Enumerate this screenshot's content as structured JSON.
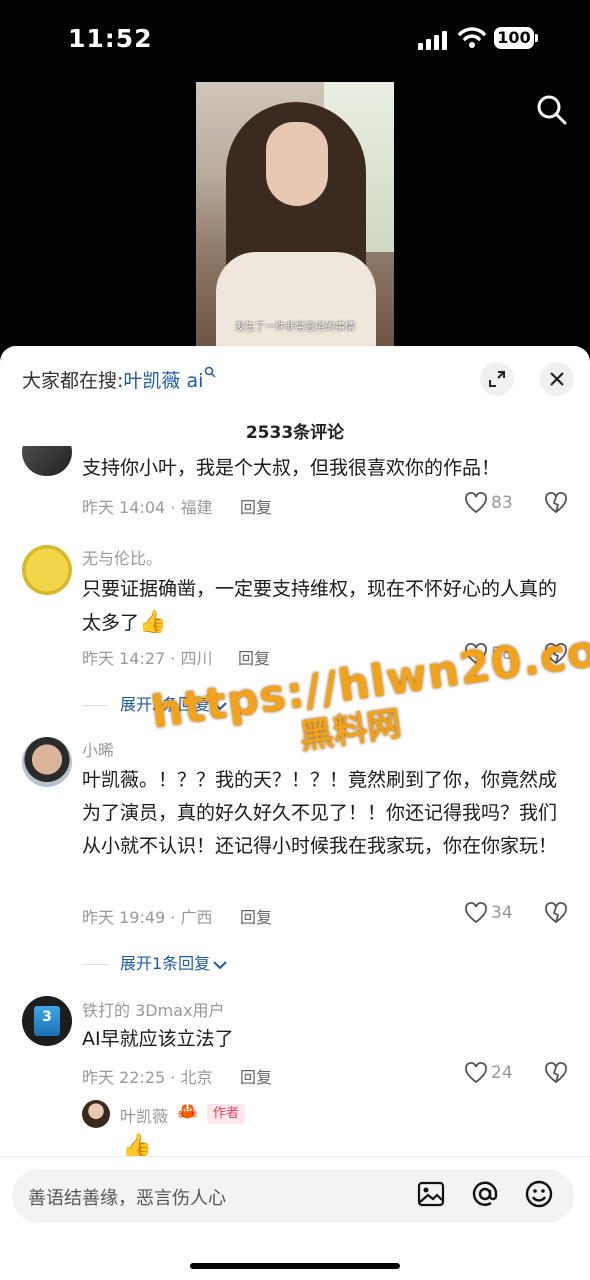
{
  "status_bar": {
    "time": "11:52",
    "battery": "100"
  },
  "video": {
    "subtitle": "发生了一件非常恶劣的事情"
  },
  "sheet": {
    "search_prefix": "大家都在搜:",
    "search_keyword": "叶凯薇 ai",
    "comment_count_title": "2533条评论"
  },
  "comments": [
    {
      "user": "",
      "text": "支持你小叶，我是个大叔，但我很喜欢你的作品！",
      "time": "昨天 14:04",
      "location": "福建",
      "reply_label": "回复",
      "likes": "83"
    },
    {
      "user": "无与伦比。",
      "text": "只要证据确凿，一定要支持维权，现在不怀好心的人真的太多了",
      "time": "昨天 14:27",
      "location": "四川",
      "reply_label": "回复",
      "likes": "58",
      "expand": "展开2条回复"
    },
    {
      "user": "小晞",
      "text": "叶凯薇。！？？我的天？！？！竟然刷到了你，你竟然成为了演员，真的好久好久不见了！！你还记得我吗？我们从小就不认识！还记得小时候我在我家玩，你在你家玩！",
      "time": "昨天 19:49",
      "location": "广西",
      "reply_label": "回复",
      "likes": "34",
      "expand": "展开1条回复"
    },
    {
      "user": "铁打的 3Dmax用户",
      "text": "AI早就应该立法了",
      "time": "昨天 22:25",
      "location": "北京",
      "reply_label": "回复",
      "likes": "24"
    }
  ],
  "sub_reply": {
    "user": "叶凯薇",
    "badge": "作者"
  },
  "watermark": {
    "url": "https://hlwn20.com",
    "site": "黑料网"
  },
  "input": {
    "placeholder": "善语结善缘，恶言伤人心"
  },
  "colors": {
    "accent_blue": "#1e5aa8",
    "watermark": "#f2a21b"
  },
  "icons": [
    "signal-icon",
    "wifi-icon",
    "search-icon",
    "expand-icon",
    "close-icon",
    "heart-icon",
    "dislike-heart-icon",
    "image-icon",
    "at-icon",
    "emoji-icon",
    "crab-icon",
    "thumbs-up-icon"
  ]
}
